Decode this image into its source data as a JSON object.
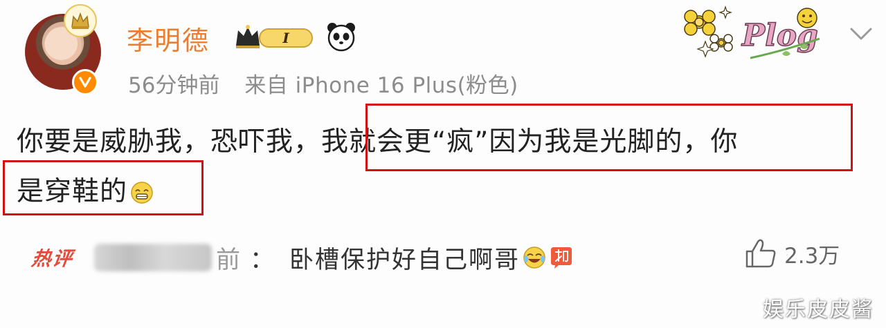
{
  "post": {
    "username": "李明德",
    "vip_level": "I",
    "time": "56分钟前",
    "source": "来自 iPhone 16 Plus(粉色)",
    "decoration_text": "Plog",
    "body_line1": "你要是威胁我，恐吓我，我就会更“疯”因为我是光脚的，你",
    "body_line2": "是穿鞋的"
  },
  "hot_comment": {
    "label": "热评",
    "name_tail": "前",
    "colon": "：",
    "text": "卧槽保护好自己啊哥"
  },
  "like": {
    "count": "2.3万"
  },
  "watermark": "娱乐皮皮酱",
  "icons": {
    "avatar_badge": "crown-icon",
    "verified": "verified-v-icon",
    "panda": "panda-icon",
    "chevron": "chevron-down-icon",
    "thumbs_up": "thumbs-up-icon"
  },
  "colors": {
    "username": "#ea7d2f",
    "highlight_box": "#d01212",
    "hot_label": "#e34b3b"
  }
}
